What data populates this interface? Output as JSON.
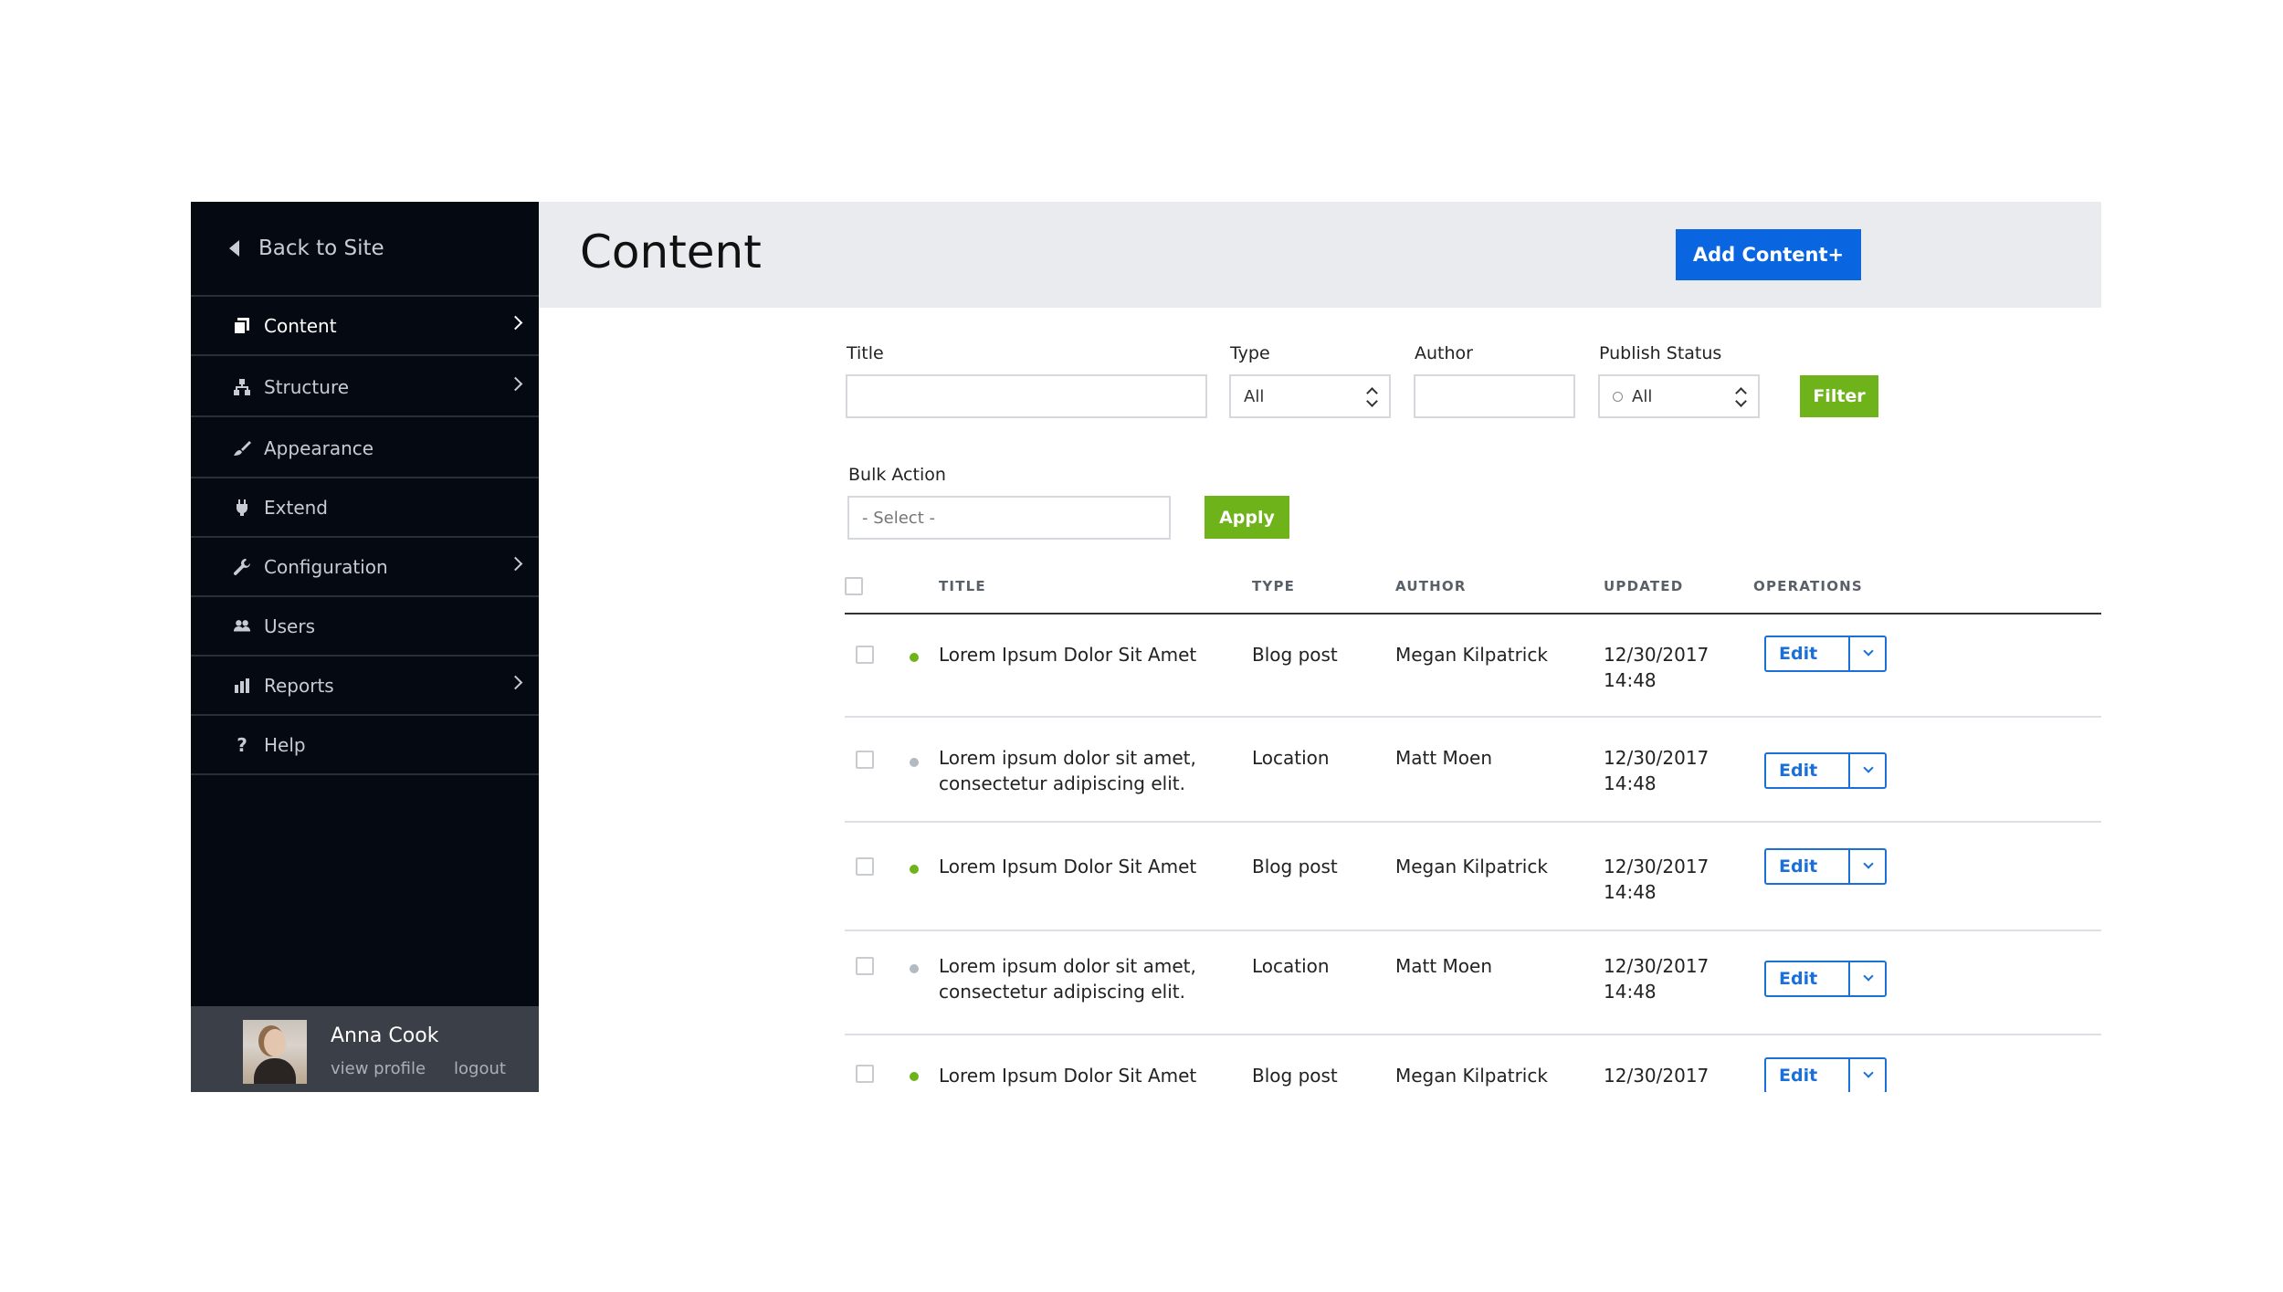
{
  "sidebar": {
    "back_label": "Back to Site",
    "items": [
      {
        "label": "Content",
        "icon": "content-icon",
        "chevron": true,
        "active": true
      },
      {
        "label": "Structure",
        "icon": "structure-icon",
        "chevron": true
      },
      {
        "label": "Appearance",
        "icon": "brush-icon",
        "chevron": false
      },
      {
        "label": "Extend",
        "icon": "plug-icon",
        "chevron": false
      },
      {
        "label": "Configuration",
        "icon": "wrench-icon",
        "chevron": true
      },
      {
        "label": "Users",
        "icon": "users-icon",
        "chevron": false
      },
      {
        "label": "Reports",
        "icon": "bar-chart-icon",
        "chevron": true
      },
      {
        "label": "Help",
        "icon": "help-icon",
        "chevron": false
      }
    ],
    "profile": {
      "name": "Anna Cook",
      "view_profile": "view profile",
      "logout": "logout"
    }
  },
  "header": {
    "title": "Content",
    "add_button": "Add Content+"
  },
  "filters": {
    "title_label": "Title",
    "title_value": "",
    "type_label": "Type",
    "type_value": "All",
    "author_label": "Author",
    "author_value": "",
    "status_label": "Publish Status",
    "status_value": "All",
    "filter_button": "Filter",
    "bulk_label": "Bulk Action",
    "bulk_placeholder": "- Select -",
    "apply_button": "Apply"
  },
  "table": {
    "columns": {
      "title": "TITLE",
      "type": "TYPE",
      "author": "AUTHOR",
      "updated": "UPDATED",
      "operations": "OPERATIONS"
    },
    "edit_label": "Edit",
    "rows": [
      {
        "title": "Lorem Ipsum Dolor Sit Amet",
        "title2": "",
        "type": "Blog post",
        "author": "Megan Kilpatrick",
        "date": "12/30/2017",
        "time": "14:48",
        "status_color": "#6fb31b"
      },
      {
        "title": "Lorem ipsum dolor sit amet,",
        "title2": "consectetur adipiscing elit.",
        "type": "Location",
        "author": "Matt Moen",
        "date": "12/30/2017",
        "time": "14:48",
        "status_color": "#b4bac1"
      },
      {
        "title": "Lorem Ipsum Dolor Sit Amet",
        "title2": "",
        "type": "Blog post",
        "author": "Megan Kilpatrick",
        "date": "12/30/2017",
        "time": "14:48",
        "status_color": "#6fb31b"
      },
      {
        "title": "Lorem ipsum dolor sit amet,",
        "title2": "consectetur adipiscing elit.",
        "type": "Location",
        "author": "Matt Moen",
        "date": "12/30/2017",
        "time": "14:48",
        "status_color": "#b4bac1"
      },
      {
        "title": "Lorem Ipsum Dolor Sit Amet",
        "title2": "",
        "type": "Blog post",
        "author": "Megan Kilpatrick",
        "date": "12/30/2017",
        "time": "",
        "status_color": "#6fb31b"
      }
    ]
  },
  "colors": {
    "primary": "#0a66e0",
    "success": "#6fb31b",
    "sidebar_bg": "#050a12"
  }
}
